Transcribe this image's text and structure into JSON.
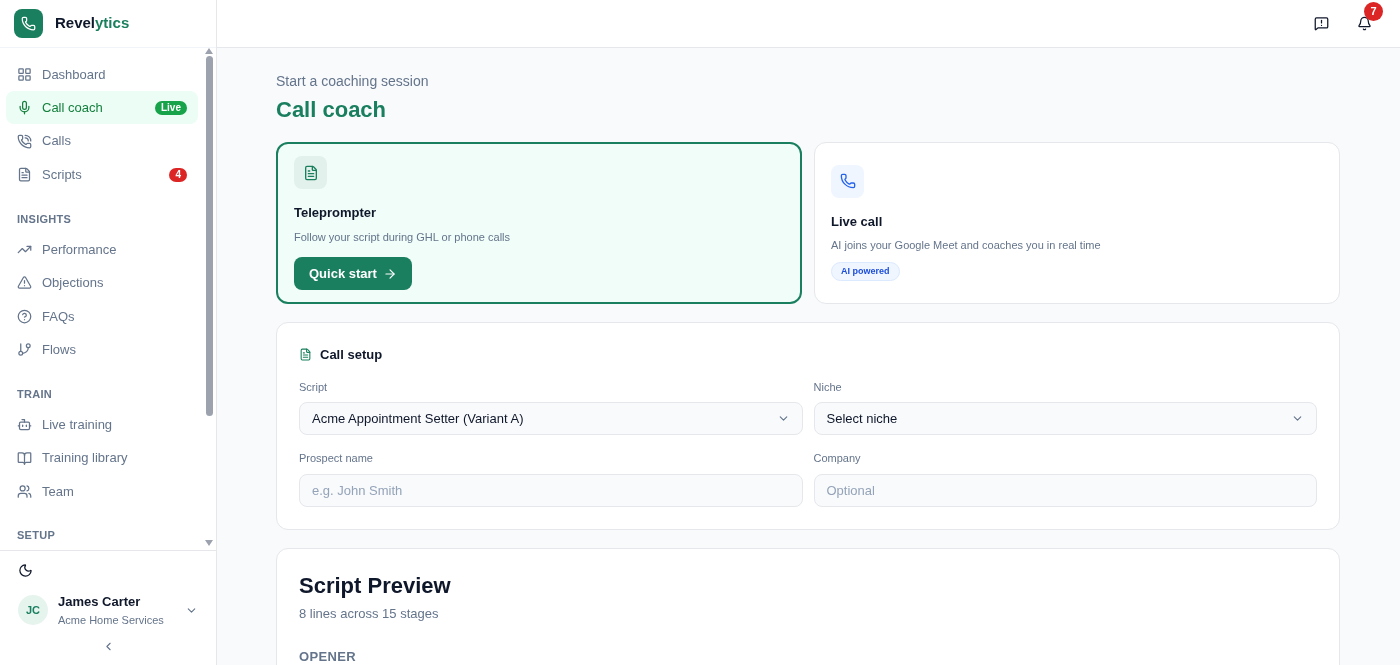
{
  "brand": {
    "name_main": "Revel",
    "name_accent": "ytics"
  },
  "nav": [
    {
      "kind": "item",
      "label": "Dashboard",
      "selected": false
    },
    {
      "kind": "item",
      "label": "Call coach",
      "selected": true,
      "badge": {
        "text": "Live",
        "color": "#16a34a"
      }
    },
    {
      "kind": "item",
      "label": "Calls",
      "selected": false
    },
    {
      "kind": "item",
      "label": "Scripts",
      "selected": false,
      "badge": {
        "text": "4",
        "color": "#dc2626"
      }
    },
    {
      "kind": "heading",
      "label": "INSIGHTS"
    },
    {
      "kind": "item",
      "label": "Performance",
      "selected": false
    },
    {
      "kind": "item",
      "label": "Objections",
      "selected": false
    },
    {
      "kind": "item",
      "label": "FAQs",
      "selected": false
    },
    {
      "kind": "item",
      "label": "Flows",
      "selected": false
    },
    {
      "kind": "heading",
      "label": "TRAIN"
    },
    {
      "kind": "item",
      "label": "Live training",
      "selected": false
    },
    {
      "kind": "item",
      "label": "Training library",
      "selected": false
    },
    {
      "kind": "item",
      "label": "Team",
      "selected": false
    },
    {
      "kind": "heading",
      "label": "SETUP"
    }
  ],
  "user": {
    "initials": "JC",
    "name": "James Carter",
    "org": "Acme Home Services"
  },
  "header": {
    "notification_count": "7"
  },
  "page": {
    "eyebrow": "Start a coaching session",
    "title": "Call coach"
  },
  "modes": [
    {
      "title": "Teleprompter",
      "description": "Follow your script during GHL or phone calls",
      "selected": true,
      "button": "Quick start"
    },
    {
      "title": "Live call",
      "description": "AI joins your Google Meet and coaches you in real time",
      "selected": false,
      "tag": "AI powered"
    }
  ],
  "setup": {
    "title": "Call setup",
    "fields": [
      {
        "kind": "select",
        "label": "Script",
        "value": "Acme Appointment Setter (Variant A)"
      },
      {
        "kind": "select",
        "label": "Niche",
        "value": "Select niche"
      },
      {
        "kind": "text",
        "label": "Prospect name",
        "placeholder": "e.g. John Smith"
      },
      {
        "kind": "text",
        "label": "Company",
        "placeholder": "Optional"
      }
    ]
  },
  "preview": {
    "title": "Script Preview",
    "subtitle": "8 lines across 15 stages",
    "section": "OPENER"
  }
}
